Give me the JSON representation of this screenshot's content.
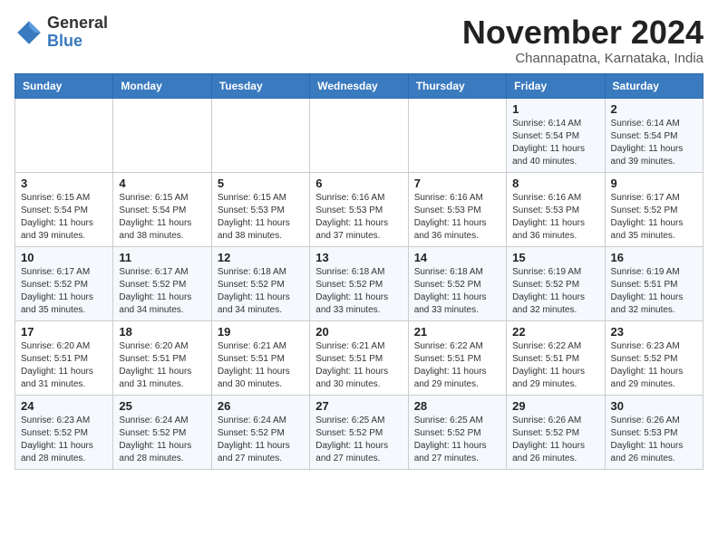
{
  "header": {
    "logo_line1": "General",
    "logo_line2": "Blue",
    "month_title": "November 2024",
    "location": "Channapatna, Karnataka, India"
  },
  "weekdays": [
    "Sunday",
    "Monday",
    "Tuesday",
    "Wednesday",
    "Thursday",
    "Friday",
    "Saturday"
  ],
  "weeks": [
    [
      {
        "day": "",
        "info": ""
      },
      {
        "day": "",
        "info": ""
      },
      {
        "day": "",
        "info": ""
      },
      {
        "day": "",
        "info": ""
      },
      {
        "day": "",
        "info": ""
      },
      {
        "day": "1",
        "info": "Sunrise: 6:14 AM\nSunset: 5:54 PM\nDaylight: 11 hours\nand 40 minutes."
      },
      {
        "day": "2",
        "info": "Sunrise: 6:14 AM\nSunset: 5:54 PM\nDaylight: 11 hours\nand 39 minutes."
      }
    ],
    [
      {
        "day": "3",
        "info": "Sunrise: 6:15 AM\nSunset: 5:54 PM\nDaylight: 11 hours\nand 39 minutes."
      },
      {
        "day": "4",
        "info": "Sunrise: 6:15 AM\nSunset: 5:54 PM\nDaylight: 11 hours\nand 38 minutes."
      },
      {
        "day": "5",
        "info": "Sunrise: 6:15 AM\nSunset: 5:53 PM\nDaylight: 11 hours\nand 38 minutes."
      },
      {
        "day": "6",
        "info": "Sunrise: 6:16 AM\nSunset: 5:53 PM\nDaylight: 11 hours\nand 37 minutes."
      },
      {
        "day": "7",
        "info": "Sunrise: 6:16 AM\nSunset: 5:53 PM\nDaylight: 11 hours\nand 36 minutes."
      },
      {
        "day": "8",
        "info": "Sunrise: 6:16 AM\nSunset: 5:53 PM\nDaylight: 11 hours\nand 36 minutes."
      },
      {
        "day": "9",
        "info": "Sunrise: 6:17 AM\nSunset: 5:52 PM\nDaylight: 11 hours\nand 35 minutes."
      }
    ],
    [
      {
        "day": "10",
        "info": "Sunrise: 6:17 AM\nSunset: 5:52 PM\nDaylight: 11 hours\nand 35 minutes."
      },
      {
        "day": "11",
        "info": "Sunrise: 6:17 AM\nSunset: 5:52 PM\nDaylight: 11 hours\nand 34 minutes."
      },
      {
        "day": "12",
        "info": "Sunrise: 6:18 AM\nSunset: 5:52 PM\nDaylight: 11 hours\nand 34 minutes."
      },
      {
        "day": "13",
        "info": "Sunrise: 6:18 AM\nSunset: 5:52 PM\nDaylight: 11 hours\nand 33 minutes."
      },
      {
        "day": "14",
        "info": "Sunrise: 6:18 AM\nSunset: 5:52 PM\nDaylight: 11 hours\nand 33 minutes."
      },
      {
        "day": "15",
        "info": "Sunrise: 6:19 AM\nSunset: 5:52 PM\nDaylight: 11 hours\nand 32 minutes."
      },
      {
        "day": "16",
        "info": "Sunrise: 6:19 AM\nSunset: 5:51 PM\nDaylight: 11 hours\nand 32 minutes."
      }
    ],
    [
      {
        "day": "17",
        "info": "Sunrise: 6:20 AM\nSunset: 5:51 PM\nDaylight: 11 hours\nand 31 minutes."
      },
      {
        "day": "18",
        "info": "Sunrise: 6:20 AM\nSunset: 5:51 PM\nDaylight: 11 hours\nand 31 minutes."
      },
      {
        "day": "19",
        "info": "Sunrise: 6:21 AM\nSunset: 5:51 PM\nDaylight: 11 hours\nand 30 minutes."
      },
      {
        "day": "20",
        "info": "Sunrise: 6:21 AM\nSunset: 5:51 PM\nDaylight: 11 hours\nand 30 minutes."
      },
      {
        "day": "21",
        "info": "Sunrise: 6:22 AM\nSunset: 5:51 PM\nDaylight: 11 hours\nand 29 minutes."
      },
      {
        "day": "22",
        "info": "Sunrise: 6:22 AM\nSunset: 5:51 PM\nDaylight: 11 hours\nand 29 minutes."
      },
      {
        "day": "23",
        "info": "Sunrise: 6:23 AM\nSunset: 5:52 PM\nDaylight: 11 hours\nand 29 minutes."
      }
    ],
    [
      {
        "day": "24",
        "info": "Sunrise: 6:23 AM\nSunset: 5:52 PM\nDaylight: 11 hours\nand 28 minutes."
      },
      {
        "day": "25",
        "info": "Sunrise: 6:24 AM\nSunset: 5:52 PM\nDaylight: 11 hours\nand 28 minutes."
      },
      {
        "day": "26",
        "info": "Sunrise: 6:24 AM\nSunset: 5:52 PM\nDaylight: 11 hours\nand 27 minutes."
      },
      {
        "day": "27",
        "info": "Sunrise: 6:25 AM\nSunset: 5:52 PM\nDaylight: 11 hours\nand 27 minutes."
      },
      {
        "day": "28",
        "info": "Sunrise: 6:25 AM\nSunset: 5:52 PM\nDaylight: 11 hours\nand 27 minutes."
      },
      {
        "day": "29",
        "info": "Sunrise: 6:26 AM\nSunset: 5:52 PM\nDaylight: 11 hours\nand 26 minutes."
      },
      {
        "day": "30",
        "info": "Sunrise: 6:26 AM\nSunset: 5:53 PM\nDaylight: 11 hours\nand 26 minutes."
      }
    ]
  ]
}
